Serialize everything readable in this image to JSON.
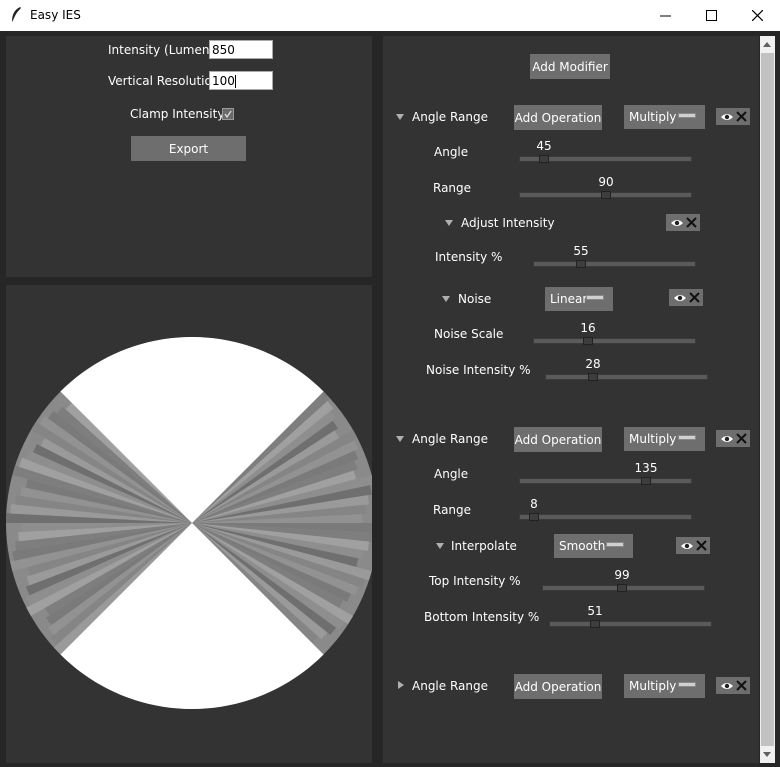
{
  "window": {
    "title": "Easy IES"
  },
  "top_panel": {
    "intensity_label": "Intensity (Lumens)",
    "intensity_value": "850",
    "vres_label": "Vertical Resolution",
    "vres_value": "100",
    "clamp_label": "Clamp Intensity",
    "clamp_checked": true,
    "export_label": "Export"
  },
  "preview": {
    "icon": "light-distribution-preview"
  },
  "modifiers": {
    "add_modifier_label": "Add Modifier",
    "add_operation_label": "Add Operation",
    "items": [
      {
        "title": "Angle Range",
        "blend": "Multiply",
        "expanded": true,
        "params": [
          {
            "label": "Angle",
            "value": "45",
            "fraction": 0.125
          },
          {
            "label": "Range",
            "value": "90",
            "fraction": 0.5
          }
        ],
        "operations": [
          {
            "title": "Adjust Intensity",
            "params": [
              {
                "label": "Intensity %",
                "value": "55",
                "fraction": 0.28
              }
            ]
          },
          {
            "title": "Noise",
            "mode": "Linear",
            "params": [
              {
                "label": "Noise Scale",
                "value": "16",
                "fraction": 0.33
              },
              {
                "label": "Noise Intensity %",
                "value": "28",
                "fraction": 0.28
              }
            ]
          }
        ]
      },
      {
        "title": "Angle Range",
        "blend": "Multiply",
        "expanded": true,
        "params": [
          {
            "label": "Angle",
            "value": "135",
            "fraction": 0.75
          },
          {
            "label": "Range",
            "value": "8",
            "fraction": 0.06
          }
        ],
        "operations": [
          {
            "title": "Interpolate",
            "mode": "Smooth",
            "params": [
              {
                "label": "Top Intensity %",
                "value": "99",
                "fraction": 0.49
              },
              {
                "label": "Bottom Intensity %",
                "value": "51",
                "fraction": 0.27
              }
            ]
          }
        ]
      },
      {
        "title": "Angle Range",
        "blend": "Multiply",
        "expanded": false
      }
    ]
  },
  "colors": {
    "panel": "#333333",
    "frame": "#262626",
    "button": "#6e6e6e"
  }
}
